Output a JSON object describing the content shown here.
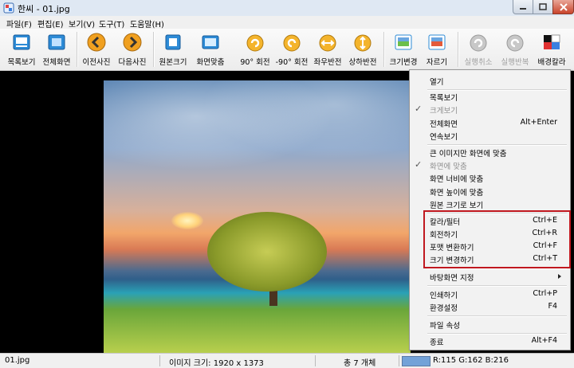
{
  "window": {
    "title": "한씨 - 01.jpg"
  },
  "menubar": [
    {
      "label": "파일(F)"
    },
    {
      "label": "편집(E)"
    },
    {
      "label": "보기(V)"
    },
    {
      "label": "도구(T)"
    },
    {
      "label": "도움말(H)"
    }
  ],
  "toolbar": [
    {
      "label": "목록보기",
      "icon": "list-view-icon",
      "enabled": true
    },
    {
      "label": "전체화면",
      "icon": "fullscreen-icon",
      "enabled": true
    },
    {
      "label": "이전사진",
      "icon": "prev-photo-icon",
      "enabled": true
    },
    {
      "label": "다음사진",
      "icon": "next-photo-icon",
      "enabled": true
    },
    {
      "label": "원본크기",
      "icon": "original-size-icon",
      "enabled": true
    },
    {
      "label": "화면맞춤",
      "icon": "fit-screen-icon",
      "enabled": true
    },
    {
      "label": "90° 회전",
      "icon": "rotate-cw-icon",
      "enabled": true
    },
    {
      "label": "-90° 회전",
      "icon": "rotate-ccw-icon",
      "enabled": true
    },
    {
      "label": "좌우반전",
      "icon": "flip-horizontal-icon",
      "enabled": true
    },
    {
      "label": "상하반전",
      "icon": "flip-vertical-icon",
      "enabled": true
    },
    {
      "label": "크기변경",
      "icon": "resize-icon",
      "enabled": true
    },
    {
      "label": "자르기",
      "icon": "crop-icon",
      "enabled": true
    },
    {
      "label": "실행취소",
      "icon": "undo-icon",
      "enabled": false
    },
    {
      "label": "실행반복",
      "icon": "redo-icon",
      "enabled": false
    },
    {
      "label": "배경칼라",
      "icon": "background-color-icon",
      "enabled": true
    }
  ],
  "context_menu": [
    {
      "label": "열기",
      "shortcut": "",
      "checked": false,
      "disabled": false
    },
    {
      "label": "목록보기",
      "shortcut": "",
      "checked": false,
      "disabled": false
    },
    {
      "label": "크게보기",
      "shortcut": "",
      "checked": true,
      "disabled": true
    },
    {
      "label": "전체화면",
      "shortcut": "Alt+Enter",
      "checked": false,
      "disabled": false
    },
    {
      "label": "연속보기",
      "shortcut": "",
      "checked": false,
      "disabled": false
    },
    {
      "label": "큰 이미지만 화면에 맞춤",
      "shortcut": "",
      "checked": false,
      "disabled": false
    },
    {
      "label": "화면에 맞춤",
      "shortcut": "",
      "checked": true,
      "disabled": true
    },
    {
      "label": "화면 너비에 맞춤",
      "shortcut": "",
      "checked": false,
      "disabled": false
    },
    {
      "label": "화면 높이에 맞춤",
      "shortcut": "",
      "checked": false,
      "disabled": false
    },
    {
      "label": "원본 크기로 보기",
      "shortcut": "",
      "checked": false,
      "disabled": false
    },
    {
      "label": "칼라/필터",
      "shortcut": "Ctrl+E",
      "checked": false,
      "disabled": false
    },
    {
      "label": "회전하기",
      "shortcut": "Ctrl+R",
      "checked": false,
      "disabled": false
    },
    {
      "label": "포맷 변환하기",
      "shortcut": "Ctrl+F",
      "checked": false,
      "disabled": false
    },
    {
      "label": "크기 변경하기",
      "shortcut": "Ctrl+T",
      "checked": false,
      "disabled": false
    },
    {
      "label": "바탕화면 지정",
      "shortcut": "",
      "checked": false,
      "disabled": false,
      "submenu": true
    },
    {
      "label": "인쇄하기",
      "shortcut": "Ctrl+P",
      "checked": false,
      "disabled": false
    },
    {
      "label": "환경설정",
      "shortcut": "F4",
      "checked": false,
      "disabled": false
    },
    {
      "label": "파일 속성",
      "shortcut": "",
      "checked": false,
      "disabled": false
    },
    {
      "label": "종료",
      "shortcut": "Alt+F4",
      "checked": false,
      "disabled": false
    }
  ],
  "status": {
    "filename": "01.jpg",
    "image_size": "이미지 크기: 1920 x 1373",
    "count": "총 7 개체",
    "pixel_color": "R:115 G:162 B:216",
    "pixel_color_hex": "#73a2d8"
  },
  "colors": {
    "highlight_box": "#c0181f",
    "viewer_bg": "#000000"
  }
}
